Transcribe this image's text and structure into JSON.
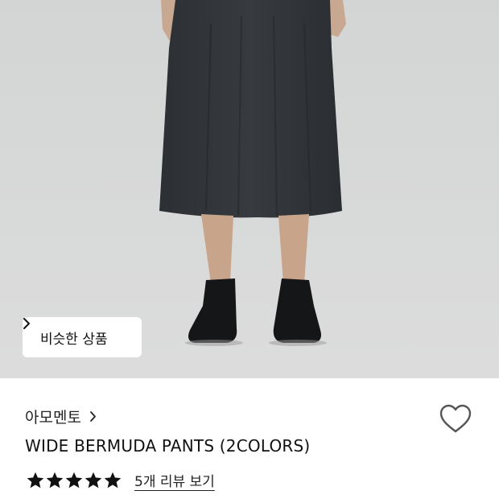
{
  "similar_button": {
    "label": "비슷한 상품",
    "icon": "chevron-right-icon"
  },
  "product": {
    "brand": "아모멘토",
    "title": "WIDE BERMUDA PANTS (2COLORS)",
    "rating": 5,
    "rating_max": 5,
    "review_link": "5개 리뷰 보기"
  },
  "icons": {
    "wishlist": "heart-outline-icon",
    "brand_chevron": "chevron-right-icon"
  },
  "colors": {
    "photo_bg": "#d7d8d8",
    "text": "#111111",
    "star": "#111111"
  }
}
